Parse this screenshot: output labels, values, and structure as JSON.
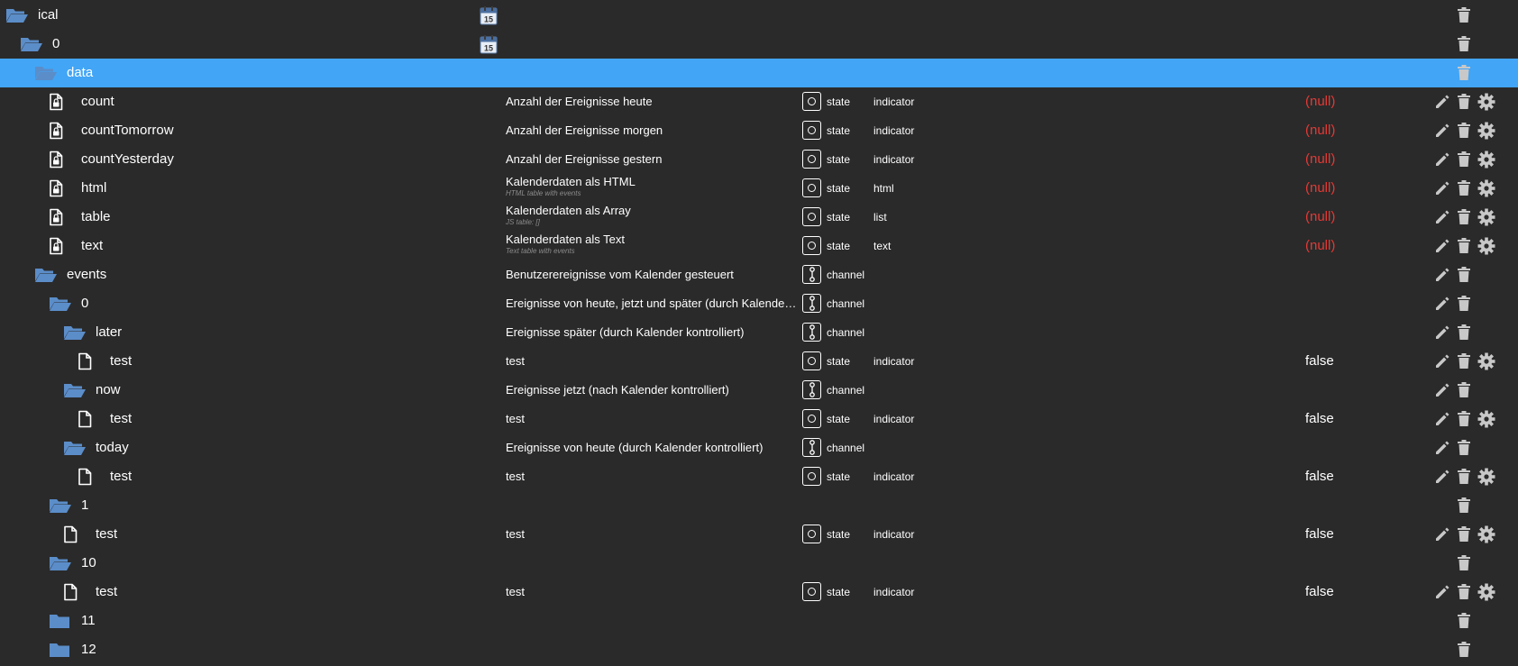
{
  "colors": {
    "background": "#2a2a2a",
    "selected_row": "#42a5f5",
    "folder_icon": "#5b8dc9",
    "null_value": "#e53935",
    "action_icon": "#c8c8c8"
  },
  "rows": [
    {
      "name": "ical",
      "icon": "folder-open-icon",
      "indent": 0,
      "calendar_icon": true,
      "actions": "trash"
    },
    {
      "name": "0",
      "icon": "folder-open-icon",
      "indent": 1,
      "calendar_icon": true,
      "actions": "trash"
    },
    {
      "name": "data",
      "icon": "folder-open-icon",
      "indent": 2,
      "selected": true,
      "actions": "trash"
    },
    {
      "name": "count",
      "icon": "file-lock-icon",
      "indent": 3,
      "desc": "Anzahl der Ereignisse heute",
      "type": "state",
      "role": "indicator",
      "value": "(null)",
      "value_null": true,
      "actions": "full"
    },
    {
      "name": "countTomorrow",
      "icon": "file-lock-icon",
      "indent": 3,
      "desc": "Anzahl der Ereignisse morgen",
      "type": "state",
      "role": "indicator",
      "value": "(null)",
      "value_null": true,
      "actions": "full"
    },
    {
      "name": "countYesterday",
      "icon": "file-lock-icon",
      "indent": 3,
      "desc": "Anzahl der Ereignisse gestern",
      "type": "state",
      "role": "indicator",
      "value": "(null)",
      "value_null": true,
      "actions": "full"
    },
    {
      "name": "html",
      "icon": "file-lock-icon",
      "indent": 3,
      "desc": "Kalenderdaten als HTML",
      "desc_sub": "HTML table with events",
      "type": "state",
      "role": "html",
      "value": "(null)",
      "value_null": true,
      "actions": "full"
    },
    {
      "name": "table",
      "icon": "file-lock-icon",
      "indent": 3,
      "desc": "Kalenderdaten als Array",
      "desc_sub": "JS table: []",
      "type": "state",
      "role": "list",
      "value": "(null)",
      "value_null": true,
      "actions": "full"
    },
    {
      "name": "text",
      "icon": "file-lock-icon",
      "indent": 3,
      "desc": "Kalenderdaten als Text",
      "desc_sub": "Text table with events",
      "type": "state",
      "role": "text",
      "value": "(null)",
      "value_null": true,
      "actions": "full"
    },
    {
      "name": "events",
      "icon": "folder-open-icon",
      "indent": 2,
      "desc": "Benutzerereignisse vom Kalender gesteuert",
      "type": "channel",
      "actions": "edit-trash"
    },
    {
      "name": "0",
      "icon": "folder-open-icon",
      "indent": 3,
      "desc": "Ereignisse von heute, jetzt und später (durch Kalender kontrolliert)",
      "type": "channel",
      "actions": "edit-trash"
    },
    {
      "name": "later",
      "icon": "folder-open-icon",
      "indent": 4,
      "desc": "Ereignisse später (durch Kalender kontrolliert)",
      "type": "channel",
      "actions": "edit-trash"
    },
    {
      "name": "test",
      "icon": "file-icon",
      "indent": 5,
      "desc": "test",
      "type": "state",
      "role": "indicator",
      "value": "false",
      "actions": "full"
    },
    {
      "name": "now",
      "icon": "folder-open-icon",
      "indent": 4,
      "desc": "Ereignisse jetzt (nach Kalender kontrolliert)",
      "type": "channel",
      "actions": "edit-trash"
    },
    {
      "name": "test",
      "icon": "file-icon",
      "indent": 5,
      "desc": "test",
      "type": "state",
      "role": "indicator",
      "value": "false",
      "actions": "full"
    },
    {
      "name": "today",
      "icon": "folder-open-icon",
      "indent": 4,
      "desc": "Ereignisse von heute (durch Kalender kontrolliert)",
      "type": "channel",
      "actions": "edit-trash"
    },
    {
      "name": "test",
      "icon": "file-icon",
      "indent": 5,
      "desc": "test",
      "type": "state",
      "role": "indicator",
      "value": "false",
      "actions": "full"
    },
    {
      "name": "1",
      "icon": "folder-open-icon",
      "indent": 3,
      "actions": "trash"
    },
    {
      "name": "test",
      "icon": "file-icon",
      "indent": 4,
      "desc": "test",
      "type": "state",
      "role": "indicator",
      "value": "false",
      "actions": "full"
    },
    {
      "name": "10",
      "icon": "folder-open-icon",
      "indent": 3,
      "actions": "trash"
    },
    {
      "name": "test",
      "icon": "file-icon",
      "indent": 4,
      "desc": "test",
      "type": "state",
      "role": "indicator",
      "value": "false",
      "actions": "full"
    },
    {
      "name": "11",
      "icon": "folder-closed-icon",
      "indent": 3,
      "actions": "trash"
    },
    {
      "name": "12",
      "icon": "folder-closed-icon",
      "indent": 3,
      "actions": "trash"
    }
  ]
}
